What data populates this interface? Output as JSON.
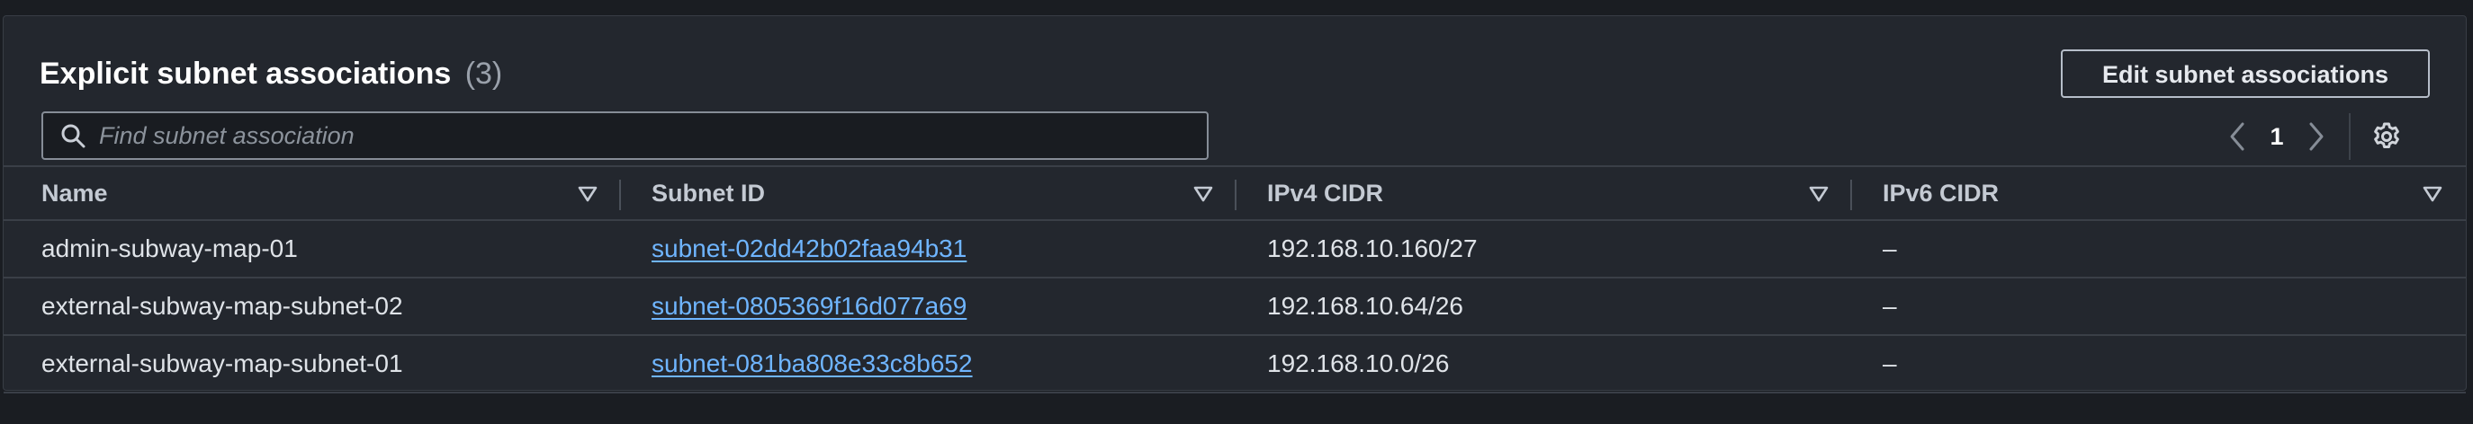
{
  "panel": {
    "title": "Explicit subnet associations",
    "count": "(3)",
    "edit_button_label": "Edit subnet associations"
  },
  "search": {
    "placeholder": "Find subnet association",
    "value": ""
  },
  "pagination": {
    "current_page": "1"
  },
  "table": {
    "headers": [
      "Name",
      "Subnet ID",
      "IPv4 CIDR",
      "IPv6 CIDR"
    ],
    "rows": [
      {
        "name": "admin-subway-map-01",
        "subnet_id": "subnet-02dd42b02faa94b31",
        "ipv4": "192.168.10.160/27",
        "ipv6": "–"
      },
      {
        "name": "external-subway-map-subnet-02",
        "subnet_id": "subnet-0805369f16d077a69",
        "ipv4": "192.168.10.64/26",
        "ipv6": "–"
      },
      {
        "name": "external-subway-map-subnet-01",
        "subnet_id": "subnet-081ba808e33c8b652",
        "ipv4": "192.168.10.0/26",
        "ipv6": "–"
      }
    ]
  },
  "colors": {
    "background": "#1a1d22",
    "panel": "#23272e",
    "link": "#6fb5ff",
    "text": "#dfe3e8"
  },
  "icons": [
    "search-icon",
    "chevron-left-icon",
    "chevron-right-icon",
    "settings-gear-icon",
    "sort-icon"
  ]
}
